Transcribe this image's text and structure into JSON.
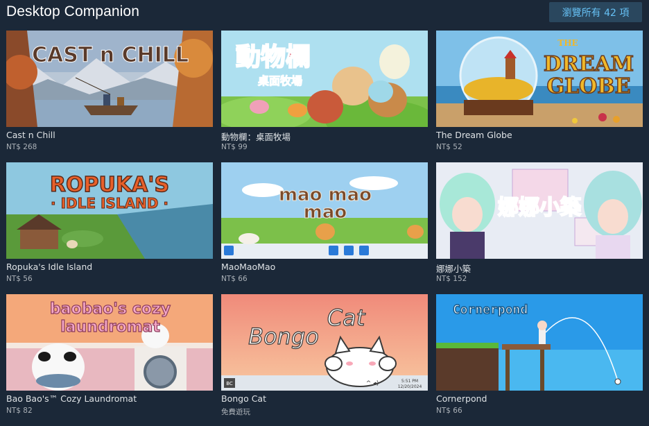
{
  "header": {
    "title": "Desktop Companion",
    "browse_all_label": "瀏覽所有 42 項"
  },
  "colors": {
    "background": "#1b2838",
    "button_bg": "#2a475e",
    "button_text": "#66c0f4"
  },
  "items": [
    {
      "name": "Cast n Chill",
      "price": "NT$ 268",
      "cover_text": "CAST n CHILL"
    },
    {
      "name": "動物欄：桌面牧場",
      "price": "NT$ 99",
      "cover_text": "動物欄",
      "cover_subtext": "桌面牧場"
    },
    {
      "name": "The Dream Globe",
      "price": "NT$ 52",
      "cover_text": "THE DREAM GLOBE"
    },
    {
      "name": "Ropuka's Idle Island",
      "price": "NT$ 56",
      "cover_text": "ROPUKA'S",
      "cover_subtext": "· IDLE ISLAND ·"
    },
    {
      "name": "MaoMaoMao",
      "price": "NT$ 66",
      "cover_text": "mao mao mao"
    },
    {
      "name": "娜娜小築",
      "price": "NT$ 152",
      "cover_text": "娜娜小築"
    },
    {
      "name": "Bao Bao's™ Cozy Laundromat",
      "price": "NT$ 82",
      "cover_text": "baobao's cozy laundromat"
    },
    {
      "name": "Bongo Cat",
      "price": "免費遊玩",
      "cover_text": "Bongo Cat",
      "cover_time": "5:51 PM",
      "cover_date": "12/20/2024"
    },
    {
      "name": "Cornerpond",
      "price": "NT$ 66",
      "cover_text": "Cornerpond"
    }
  ]
}
